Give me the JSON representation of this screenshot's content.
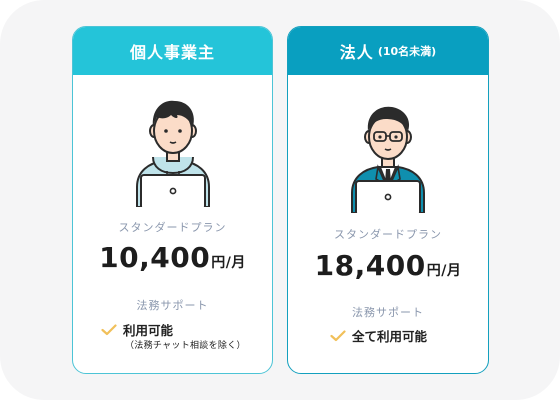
{
  "plans": [
    {
      "header_title": "個人事業主",
      "header_sub": "",
      "plan_label": "スタンダードプラン",
      "price_value": "10,400",
      "price_unit": "円/月",
      "support_label": "法務サポート",
      "support_value": "利用可能",
      "support_note": "（法務チャット相談を除く）",
      "icon": "person-with-laptop-hoodie"
    },
    {
      "header_title": "法人",
      "header_sub": "(10名未満)",
      "plan_label": "スタンダードプラン",
      "price_value": "18,400",
      "price_unit": "円/月",
      "support_label": "法務サポート",
      "support_value": "全て利用可能",
      "icon": "businessman-with-laptop"
    }
  ],
  "colors": {
    "individual_header": "#24c4d9",
    "corporate_header": "#099fc0",
    "check": "#f1c05a",
    "muted_label": "#8a97ad"
  }
}
